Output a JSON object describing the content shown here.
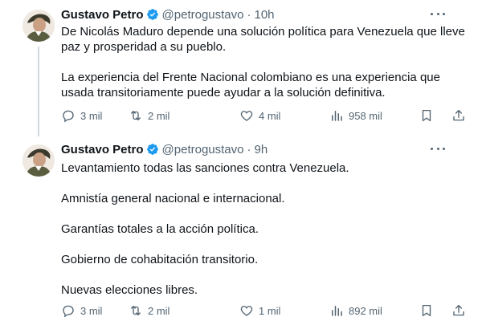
{
  "tweets": [
    {
      "author_name": "Gustavo Petro",
      "handle": "@petrogustavo",
      "separator": "·",
      "time": "10h",
      "paragraphs": [
        "De Nicolás Maduro depende una solución política para Venezuela que lleve paz y prosperidad a su pueblo.",
        "La experiencia del Frente Nacional colombiano es una experiencia que usada transitoriamente puede ayudar a la solución definitiva."
      ],
      "stats": {
        "replies": "3 mil",
        "reposts": "2 mil",
        "likes": "4 mil",
        "views": "958 mil"
      }
    },
    {
      "author_name": "Gustavo Petro",
      "handle": "@petrogustavo",
      "separator": "·",
      "time": "9h",
      "paragraphs": [
        "Levantamiento todas las sanciones contra Venezuela.",
        "Amnistía general nacional e internacional.",
        "Garantías totales a la acción política.",
        "Gobierno de cohabitación transitorio.",
        "Nuevas elecciones libres."
      ],
      "stats": {
        "replies": "3 mil",
        "reposts": "2 mil",
        "likes": "1 mil",
        "views": "892 mil"
      }
    }
  ],
  "icons": {
    "verified": "verified-badge-icon",
    "more": "more-options-icon",
    "reply": "reply-icon",
    "repost": "repost-icon",
    "like": "like-icon",
    "views": "views-icon",
    "bookmark": "bookmark-icon",
    "share": "share-icon"
  },
  "colors": {
    "text": "#0f1419",
    "secondary": "#536471",
    "verified": "#1d9bf0",
    "thread_line": "#cfd9de"
  }
}
